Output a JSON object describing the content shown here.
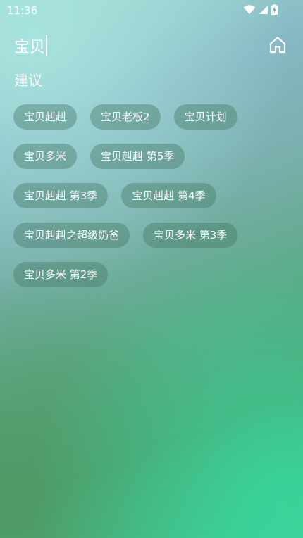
{
  "status_bar": {
    "time": "11:36",
    "icons": [
      "wifi-icon",
      "cellular-signal-icon",
      "battery-charging-icon"
    ]
  },
  "search": {
    "value": "宝贝"
  },
  "suggestions": {
    "title": "建议",
    "rows": [
      [
        "宝贝赳赳",
        "宝贝老板2",
        "宝贝计划"
      ],
      [
        "宝贝多米",
        "宝贝赳赳 第5季"
      ],
      [
        "宝贝赳赳 第3季",
        "宝贝赳赳 第4季"
      ],
      [
        "宝贝赳赳之超级奶爸",
        "宝贝多米 第3季"
      ],
      [
        "宝贝多米 第2季"
      ]
    ]
  },
  "colors": {
    "chip_background": "#46786a",
    "text": "#ffffff"
  }
}
